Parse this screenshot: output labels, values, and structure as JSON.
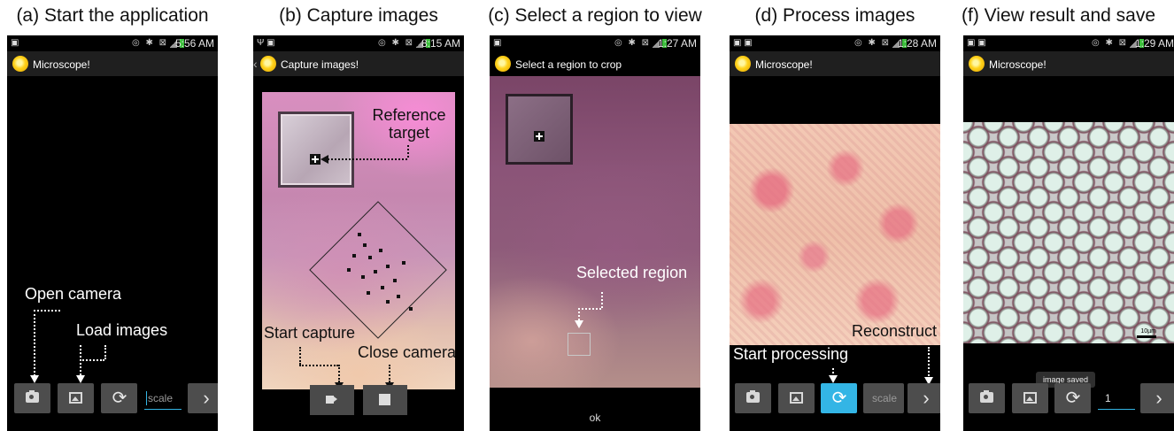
{
  "panels": {
    "a": {
      "caption": "(a) Start the application",
      "status_time": "5:56 AM",
      "app_title": "Microscope!",
      "label_open_camera": "Open camera",
      "label_load_images": "Load images",
      "scale_placeholder": "scale"
    },
    "b": {
      "caption": "(b) Capture images",
      "status_time": "8:15 AM",
      "app_title": "Capture images!",
      "label_reference_target": "Reference target",
      "label_start_capture": "Start capture",
      "label_close_camera": "Close camera"
    },
    "c": {
      "caption": "(c) Select a region to view",
      "status_time": "1:27 AM",
      "app_title": "Select a region to crop",
      "label_selected_region": "Selected region",
      "ok_label": "ok"
    },
    "d": {
      "caption": "(d) Process images",
      "status_time": "1:28 AM",
      "app_title": "Microscope!",
      "label_reconstruct": "Reconstruct",
      "label_start_processing": "Start processing",
      "scale_placeholder": "scale"
    },
    "f": {
      "caption": "(f) View result and save",
      "status_time": "1:29 AM",
      "app_title": "Microscope!",
      "toast": "image saved",
      "scale_value": "1",
      "scalebar_label": "10µm"
    }
  },
  "colors": {
    "active_button": "#33b5e5",
    "button_bg": "#4d4d4d",
    "phone_bg": "#000000"
  },
  "icons": [
    "camera-icon",
    "gallery-icon",
    "refresh-icon",
    "chevron-right-icon",
    "video-icon",
    "stop-icon",
    "app-sun-icon"
  ]
}
